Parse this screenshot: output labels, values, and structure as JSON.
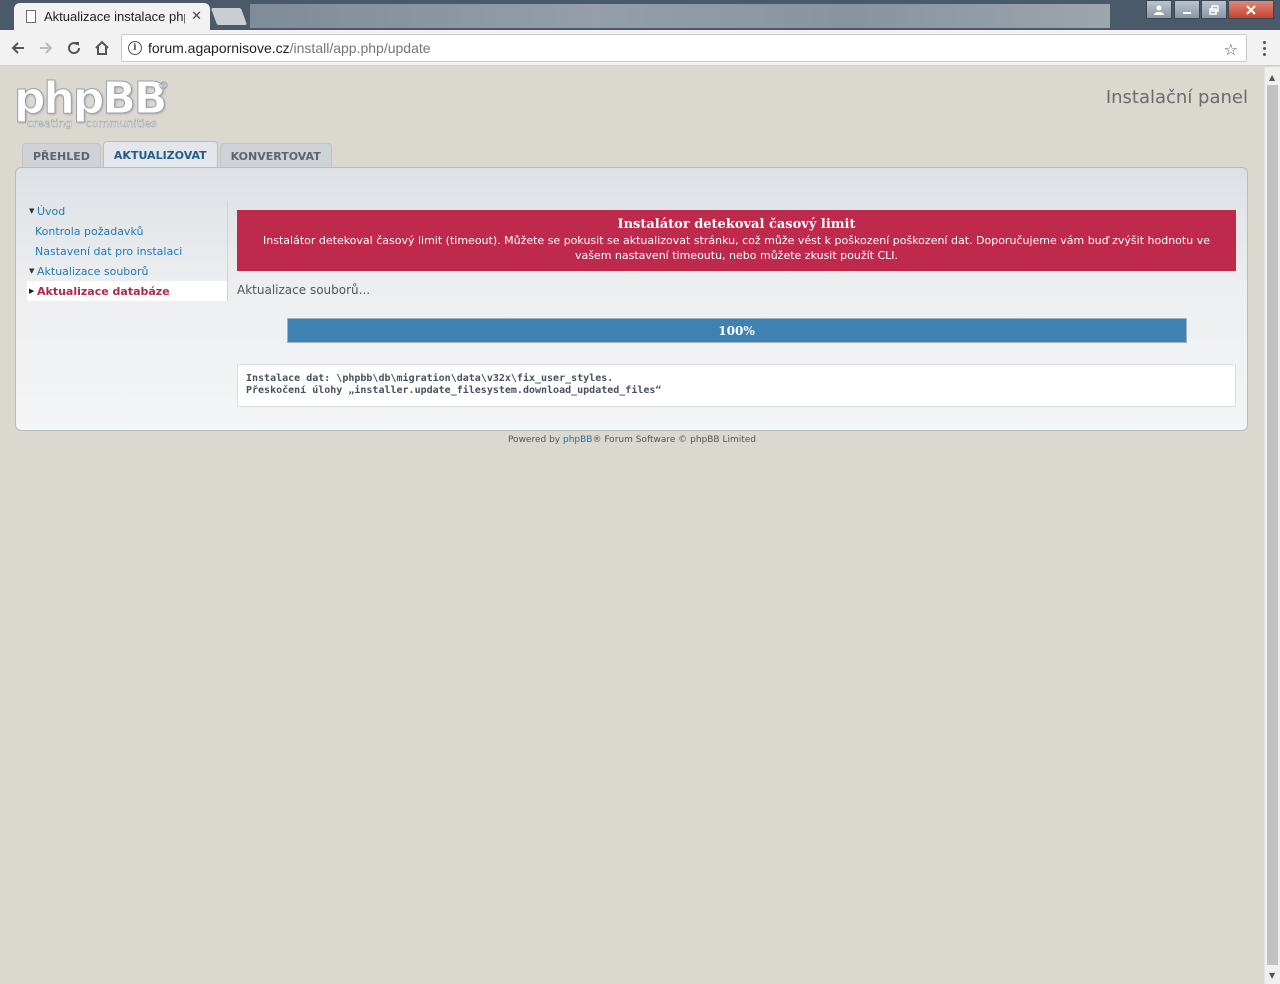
{
  "browser": {
    "tab_title": "Aktualizace instalace php",
    "url_host": "forum.agapornisove.cz",
    "url_path": "/install/app.php/update"
  },
  "header": {
    "logo_text": "phpBB",
    "logo_registered": "®",
    "logo_tagline": "creating communities",
    "panel_title": "Instalační panel"
  },
  "tabs": [
    {
      "label": "PŘEHLED",
      "active": false
    },
    {
      "label": "AKTUALIZOVAT",
      "active": true
    },
    {
      "label": "KONVERTOVAT",
      "active": false
    }
  ],
  "menu": {
    "items": [
      {
        "label": "Úvod",
        "state": "expanded"
      },
      {
        "label": "Kontrola požadavků",
        "state": "sub"
      },
      {
        "label": "Nastavení dat pro instalaci",
        "state": "sub"
      },
      {
        "label": "Aktualizace souborů",
        "state": "expanded"
      },
      {
        "label": "Aktualizace databáze",
        "state": "active"
      }
    ]
  },
  "error": {
    "title": "Instalátor detekoval časový limit",
    "message": "Instalátor detekoval časový limit (timeout). Můžete se pokusit se aktualizovat stránku, což může vést k poškození poškození dat. Doporučujeme vám buď zvýšit hodnotu ve vašem nastavení timeoutu, nebo můžete zkusit použít CLI."
  },
  "status_text": "Aktualizace souborů...",
  "progress": {
    "percent": 100,
    "label": "100%"
  },
  "log": [
    "Instalace dat: \\phpbb\\db\\migration\\data\\v32x\\fix_user_styles.",
    "Přeskočení úlohy „installer.update_filesystem.download_updated_files“"
  ],
  "footer": {
    "prefix": "Powered by ",
    "link": "phpBB",
    "suffix": "® Forum Software © phpBB Limited"
  },
  "colors": {
    "error_bg": "#bf2a4c",
    "progress_fill": "#3d82b0",
    "link": "#1e7bb8",
    "active_menu": "#b22a4a"
  }
}
